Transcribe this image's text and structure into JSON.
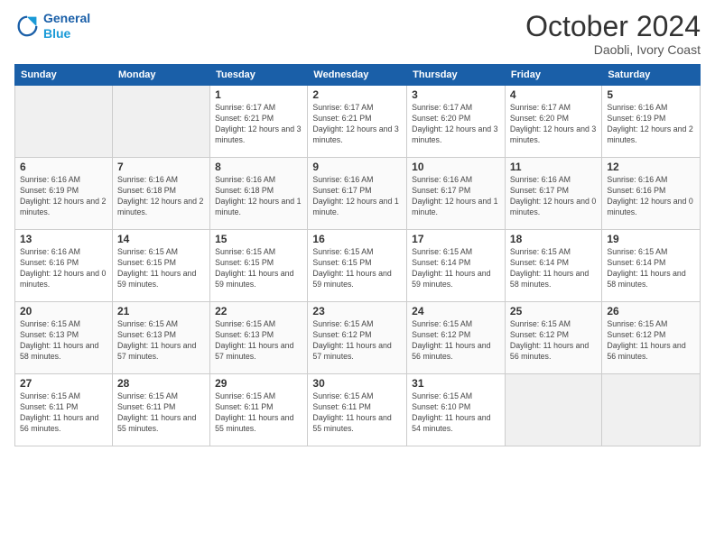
{
  "logo": {
    "line1": "General",
    "line2": "Blue"
  },
  "title": "October 2024",
  "subtitle": "Daobli, Ivory Coast",
  "headers": [
    "Sunday",
    "Monday",
    "Tuesday",
    "Wednesday",
    "Thursday",
    "Friday",
    "Saturday"
  ],
  "weeks": [
    [
      {
        "date": "",
        "info": ""
      },
      {
        "date": "",
        "info": ""
      },
      {
        "date": "1",
        "info": "Sunrise: 6:17 AM\nSunset: 6:21 PM\nDaylight: 12 hours and 3 minutes."
      },
      {
        "date": "2",
        "info": "Sunrise: 6:17 AM\nSunset: 6:21 PM\nDaylight: 12 hours and 3 minutes."
      },
      {
        "date": "3",
        "info": "Sunrise: 6:17 AM\nSunset: 6:20 PM\nDaylight: 12 hours and 3 minutes."
      },
      {
        "date": "4",
        "info": "Sunrise: 6:17 AM\nSunset: 6:20 PM\nDaylight: 12 hours and 3 minutes."
      },
      {
        "date": "5",
        "info": "Sunrise: 6:16 AM\nSunset: 6:19 PM\nDaylight: 12 hours and 2 minutes."
      }
    ],
    [
      {
        "date": "6",
        "info": "Sunrise: 6:16 AM\nSunset: 6:19 PM\nDaylight: 12 hours and 2 minutes."
      },
      {
        "date": "7",
        "info": "Sunrise: 6:16 AM\nSunset: 6:18 PM\nDaylight: 12 hours and 2 minutes."
      },
      {
        "date": "8",
        "info": "Sunrise: 6:16 AM\nSunset: 6:18 PM\nDaylight: 12 hours and 1 minute."
      },
      {
        "date": "9",
        "info": "Sunrise: 6:16 AM\nSunset: 6:17 PM\nDaylight: 12 hours and 1 minute."
      },
      {
        "date": "10",
        "info": "Sunrise: 6:16 AM\nSunset: 6:17 PM\nDaylight: 12 hours and 1 minute."
      },
      {
        "date": "11",
        "info": "Sunrise: 6:16 AM\nSunset: 6:17 PM\nDaylight: 12 hours and 0 minutes."
      },
      {
        "date": "12",
        "info": "Sunrise: 6:16 AM\nSunset: 6:16 PM\nDaylight: 12 hours and 0 minutes."
      }
    ],
    [
      {
        "date": "13",
        "info": "Sunrise: 6:16 AM\nSunset: 6:16 PM\nDaylight: 12 hours and 0 minutes."
      },
      {
        "date": "14",
        "info": "Sunrise: 6:15 AM\nSunset: 6:15 PM\nDaylight: 11 hours and 59 minutes."
      },
      {
        "date": "15",
        "info": "Sunrise: 6:15 AM\nSunset: 6:15 PM\nDaylight: 11 hours and 59 minutes."
      },
      {
        "date": "16",
        "info": "Sunrise: 6:15 AM\nSunset: 6:15 PM\nDaylight: 11 hours and 59 minutes."
      },
      {
        "date": "17",
        "info": "Sunrise: 6:15 AM\nSunset: 6:14 PM\nDaylight: 11 hours and 59 minutes."
      },
      {
        "date": "18",
        "info": "Sunrise: 6:15 AM\nSunset: 6:14 PM\nDaylight: 11 hours and 58 minutes."
      },
      {
        "date": "19",
        "info": "Sunrise: 6:15 AM\nSunset: 6:14 PM\nDaylight: 11 hours and 58 minutes."
      }
    ],
    [
      {
        "date": "20",
        "info": "Sunrise: 6:15 AM\nSunset: 6:13 PM\nDaylight: 11 hours and 58 minutes."
      },
      {
        "date": "21",
        "info": "Sunrise: 6:15 AM\nSunset: 6:13 PM\nDaylight: 11 hours and 57 minutes."
      },
      {
        "date": "22",
        "info": "Sunrise: 6:15 AM\nSunset: 6:13 PM\nDaylight: 11 hours and 57 minutes."
      },
      {
        "date": "23",
        "info": "Sunrise: 6:15 AM\nSunset: 6:12 PM\nDaylight: 11 hours and 57 minutes."
      },
      {
        "date": "24",
        "info": "Sunrise: 6:15 AM\nSunset: 6:12 PM\nDaylight: 11 hours and 56 minutes."
      },
      {
        "date": "25",
        "info": "Sunrise: 6:15 AM\nSunset: 6:12 PM\nDaylight: 11 hours and 56 minutes."
      },
      {
        "date": "26",
        "info": "Sunrise: 6:15 AM\nSunset: 6:12 PM\nDaylight: 11 hours and 56 minutes."
      }
    ],
    [
      {
        "date": "27",
        "info": "Sunrise: 6:15 AM\nSunset: 6:11 PM\nDaylight: 11 hours and 56 minutes."
      },
      {
        "date": "28",
        "info": "Sunrise: 6:15 AM\nSunset: 6:11 PM\nDaylight: 11 hours and 55 minutes."
      },
      {
        "date": "29",
        "info": "Sunrise: 6:15 AM\nSunset: 6:11 PM\nDaylight: 11 hours and 55 minutes."
      },
      {
        "date": "30",
        "info": "Sunrise: 6:15 AM\nSunset: 6:11 PM\nDaylight: 11 hours and 55 minutes."
      },
      {
        "date": "31",
        "info": "Sunrise: 6:15 AM\nSunset: 6:10 PM\nDaylight: 11 hours and 54 minutes."
      },
      {
        "date": "",
        "info": ""
      },
      {
        "date": "",
        "info": ""
      }
    ]
  ]
}
